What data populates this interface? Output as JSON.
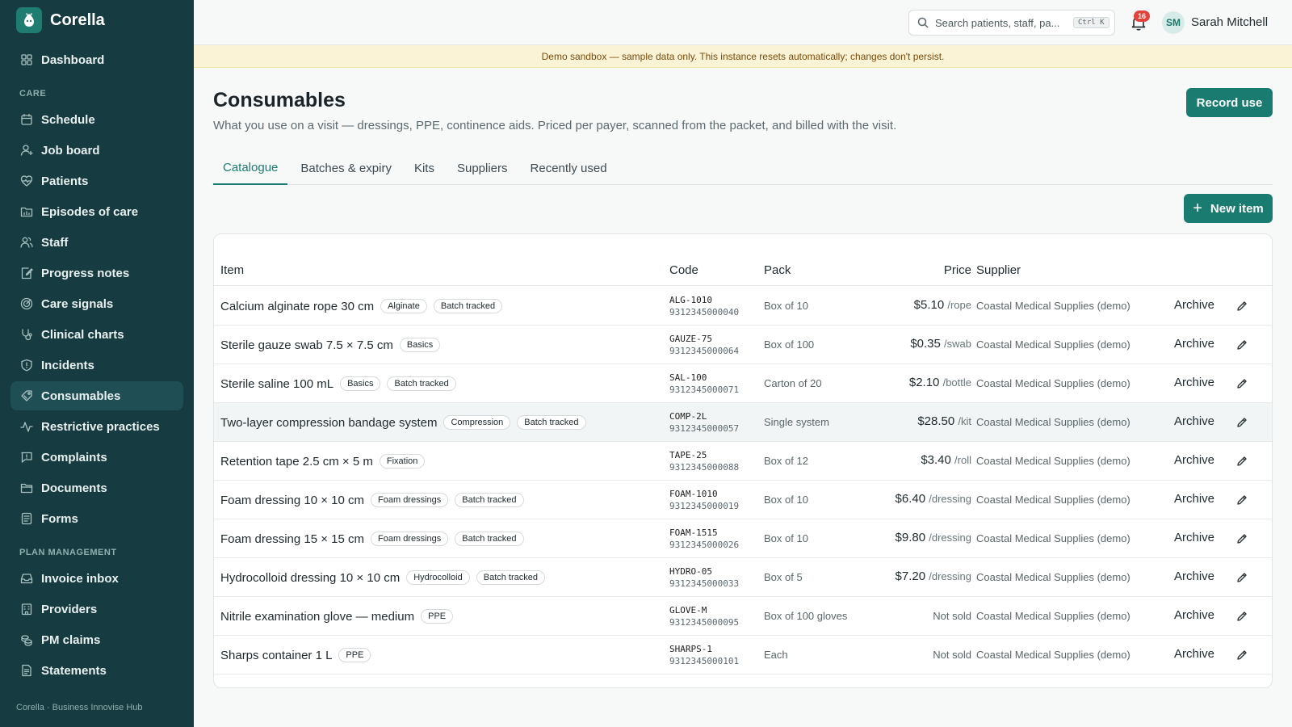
{
  "app": {
    "name": "Corella",
    "footer": "Corella · Business Innovise Hub"
  },
  "sidebar": {
    "top": [
      {
        "label": "Dashboard",
        "icon": "grid-icon"
      }
    ],
    "sections": [
      {
        "title": "CARE",
        "items": [
          {
            "label": "Schedule",
            "icon": "calendar-icon"
          },
          {
            "label": "Job board",
            "icon": "user-icon"
          },
          {
            "label": "Patients",
            "icon": "heart-icon"
          },
          {
            "label": "Episodes of care",
            "icon": "folder-chart-icon"
          },
          {
            "label": "Staff",
            "icon": "users-icon"
          },
          {
            "label": "Progress notes",
            "icon": "note-edit-icon"
          },
          {
            "label": "Care signals",
            "icon": "signal-icon"
          },
          {
            "label": "Clinical charts",
            "icon": "stethoscope-icon"
          },
          {
            "label": "Incidents",
            "icon": "shield-icon"
          },
          {
            "label": "Consumables",
            "icon": "box-tag-icon",
            "active": true
          },
          {
            "label": "Restrictive practices",
            "icon": "activity-icon"
          },
          {
            "label": "Complaints",
            "icon": "message-icon"
          },
          {
            "label": "Documents",
            "icon": "folder-icon"
          },
          {
            "label": "Forms",
            "icon": "form-icon"
          }
        ]
      },
      {
        "title": "PLAN MANAGEMENT",
        "items": [
          {
            "label": "Invoice inbox",
            "icon": "inbox-icon"
          },
          {
            "label": "Providers",
            "icon": "building-icon"
          },
          {
            "label": "PM claims",
            "icon": "coins-icon"
          },
          {
            "label": "Statements",
            "icon": "document-icon"
          }
        ]
      }
    ]
  },
  "topbar": {
    "search_placeholder": "Search patients, staff, pa...",
    "search_shortcut": "Ctrl K",
    "notification_count": "16",
    "user_initials": "SM",
    "user_name": "Sarah Mitchell"
  },
  "banner": "Demo sandbox — sample data only. This instance resets automatically; changes don't persist.",
  "page": {
    "title": "Consumables",
    "subtitle": "What you use on a visit — dressings, PPE, continence aids. Priced per payer, scanned from the packet, and billed with the visit.",
    "record_button": "Record use",
    "new_button": "New item",
    "tabs": [
      {
        "label": "Catalogue",
        "active": true
      },
      {
        "label": "Batches & expiry"
      },
      {
        "label": "Kits"
      },
      {
        "label": "Suppliers"
      },
      {
        "label": "Recently used"
      }
    ]
  },
  "table": {
    "headers": {
      "item": "Item",
      "code": "Code",
      "pack": "Pack",
      "price": "Price",
      "supplier": "Supplier"
    },
    "archive_label": "Archive",
    "rows": [
      {
        "name": "Calcium alginate rope 30 cm",
        "tags": [
          "Alginate",
          "Batch tracked"
        ],
        "code": "ALG-1010",
        "barcode": "9312345000040",
        "pack": "Box of 10",
        "price": "$5.10",
        "unit": "/rope",
        "supplier": "Coastal Medical Supplies (demo)"
      },
      {
        "name": "Sterile gauze swab 7.5 × 7.5 cm",
        "tags": [
          "Basics"
        ],
        "code": "GAUZE-75",
        "barcode": "9312345000064",
        "pack": "Box of 100",
        "price": "$0.35",
        "unit": "/swab",
        "supplier": "Coastal Medical Supplies (demo)"
      },
      {
        "name": "Sterile saline 100 mL",
        "tags": [
          "Basics",
          "Batch tracked"
        ],
        "code": "SAL-100",
        "barcode": "9312345000071",
        "pack": "Carton of 20",
        "price": "$2.10",
        "unit": "/bottle",
        "supplier": "Coastal Medical Supplies (demo)"
      },
      {
        "name": "Two-layer compression bandage system",
        "tags": [
          "Compression",
          "Batch tracked"
        ],
        "code": "COMP-2L",
        "barcode": "9312345000057",
        "pack": "Single system",
        "price": "$28.50",
        "unit": "/kit",
        "supplier": "Coastal Medical Supplies (demo)",
        "highlight": true
      },
      {
        "name": "Retention tape 2.5 cm × 5 m",
        "tags": [
          "Fixation"
        ],
        "code": "TAPE-25",
        "barcode": "9312345000088",
        "pack": "Box of 12",
        "price": "$3.40",
        "unit": "/roll",
        "supplier": "Coastal Medical Supplies (demo)"
      },
      {
        "name": "Foam dressing 10 × 10 cm",
        "tags": [
          "Foam dressings",
          "Batch tracked"
        ],
        "code": "FOAM-1010",
        "barcode": "9312345000019",
        "pack": "Box of 10",
        "price": "$6.40",
        "unit": "/dressing",
        "supplier": "Coastal Medical Supplies (demo)"
      },
      {
        "name": "Foam dressing 15 × 15 cm",
        "tags": [
          "Foam dressings",
          "Batch tracked"
        ],
        "code": "FOAM-1515",
        "barcode": "9312345000026",
        "pack": "Box of 10",
        "price": "$9.80",
        "unit": "/dressing",
        "supplier": "Coastal Medical Supplies (demo)"
      },
      {
        "name": "Hydrocolloid dressing 10 × 10 cm",
        "tags": [
          "Hydrocolloid",
          "Batch tracked"
        ],
        "code": "HYDRO-05",
        "barcode": "9312345000033",
        "pack": "Box of 5",
        "price": "$7.20",
        "unit": "/dressing",
        "supplier": "Coastal Medical Supplies (demo)"
      },
      {
        "name": "Nitrile examination glove — medium",
        "tags": [
          "PPE"
        ],
        "code": "GLOVE-M",
        "barcode": "9312345000095",
        "pack": "Box of 100 gloves",
        "price": "Not sold",
        "unit": "",
        "supplier": "Coastal Medical Supplies (demo)"
      },
      {
        "name": "Sharps container 1 L",
        "tags": [
          "PPE"
        ],
        "code": "SHARPS-1",
        "barcode": "9312345000101",
        "pack": "Each",
        "price": "Not sold",
        "unit": "",
        "supplier": "Coastal Medical Supplies (demo)"
      }
    ]
  },
  "colors": {
    "sidebar": "#163b41",
    "accent": "#1a7c70",
    "banner": "#fbf3d6",
    "badge": "#e0443c"
  }
}
